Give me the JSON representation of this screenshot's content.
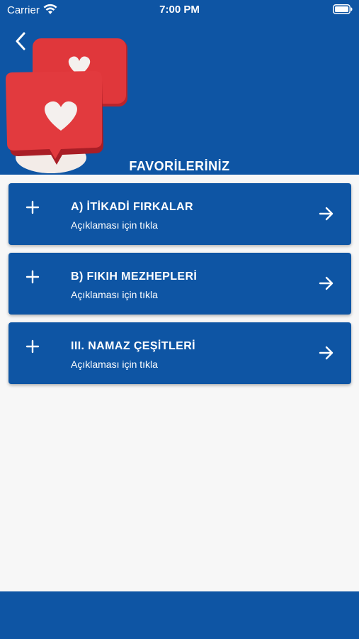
{
  "status_bar": {
    "carrier": "Carrier",
    "time": "7:00 PM",
    "icons": [
      "wifi-icon",
      "battery-icon"
    ]
  },
  "header": {
    "back_icon": "chevron-left-icon",
    "illustration": "heart-speech-bubbles",
    "title": "FAVORİLERİNİZ"
  },
  "favorites": [
    {
      "title": "A) İTİKADİ FIRKALAR",
      "subtitle": "Açıklaması için tıkla"
    },
    {
      "title": "B) FIKIH MEZHEPLERİ",
      "subtitle": "Açıklaması için tıkla"
    },
    {
      "title": "III. NAMAZ ÇEŞİTLERİ",
      "subtitle": "Açıklaması için tıkla"
    }
  ],
  "item_icons": {
    "leading": "plus-icon",
    "trailing": "arrow-right-icon"
  },
  "colors": {
    "primary": "#0e55a4",
    "background": "#f7f7f7",
    "text_on_primary": "#ffffff",
    "heart_bubble": "#e0373b"
  }
}
